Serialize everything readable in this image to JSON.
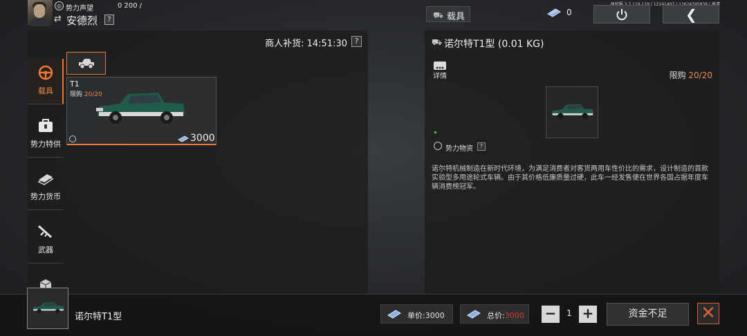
{
  "header": {
    "reputation_label": "势力声望",
    "reputation_value": "0 200 /",
    "player_name": "安德烈",
    "help": "?",
    "tab_label": "载具",
    "currency_value": "0",
    "version": "体验服 3.7.119.119 | 12141407 | 12624395836 | 高清"
  },
  "left": {
    "restock_label": "商人补货: 14:51:30",
    "help": "?",
    "categories": [
      {
        "label": "载具",
        "icon": "steering-wheel-icon"
      },
      {
        "label": "势力特供",
        "icon": "supply-case-icon"
      },
      {
        "label": "势力货币",
        "icon": "cash-icon"
      },
      {
        "label": "武器",
        "icon": "rifle-icon"
      },
      {
        "label": "",
        "icon": "crate-icon"
      }
    ],
    "item": {
      "code": "T1",
      "limit_label": "限购",
      "limit_value": "20/20",
      "price": "3000"
    }
  },
  "right": {
    "title": "诺尔特T1型 (0.01 KG)",
    "details_label": "详情",
    "limit_label": "限购",
    "limit_value": "20/20",
    "tag_label": "势力物资",
    "help": "?",
    "description": "诺尔特机械制造在新时代环境，为满足消费者对客货两用车性价比的需求，设计制造的首款实验型多用途轮式车辆。由于其价格低廉质量过硬，此车一经发售便在世界各国占据年度车辆消费榜冠军。"
  },
  "bottom": {
    "item_name": "诺尔特T1型",
    "unit_label": "单价:",
    "unit_value": "3000",
    "total_label": "总价:",
    "total_value": "3000",
    "minus": "−",
    "quantity": "1",
    "plus": "+",
    "buy_label": "资金不足",
    "close": "✕"
  },
  "colors": {
    "accent": "#f07836",
    "warning": "#d83b2e",
    "truck": "#1f5a4a"
  }
}
